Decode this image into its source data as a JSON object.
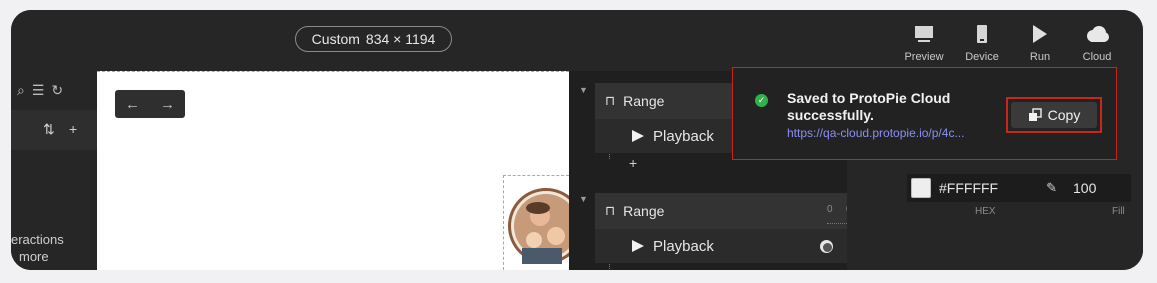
{
  "topbar": {
    "device_preset": "Custom",
    "device_size": "834 × 1194",
    "buttons": [
      {
        "label": "Preview",
        "icon": "monitor-icon"
      },
      {
        "label": "Device",
        "icon": "phone-icon"
      },
      {
        "label": "Run",
        "icon": "play-icon"
      },
      {
        "label": "Cloud",
        "icon": "cloud-icon"
      }
    ]
  },
  "left_panel": {
    "icons": [
      "search-icon",
      "list-icon",
      "refresh-icon"
    ],
    "row_icons": [
      "sort-icon",
      "add-icon"
    ],
    "bottom_text_line1": "eractions",
    "bottom_text_line2": "more"
  },
  "canvas": {
    "nav_back": "←",
    "nav_forward": "→"
  },
  "timeline": {
    "groups": [
      {
        "trigger": "Range",
        "response": "Playback",
        "add": "+"
      },
      {
        "trigger": "Range",
        "response": "Playback",
        "add": "+"
      }
    ],
    "ruler_labels": [
      "0",
      "0"
    ]
  },
  "properties": {
    "color_hex": "#FFFFFF",
    "hex_label": "HEX",
    "fill_value": "100",
    "fill_label": "Fill"
  },
  "toast": {
    "message": "Saved to ProtoPie Cloud successfully.",
    "link": "https://qa-cloud.protopie.io/p/4c...",
    "copy_label": "Copy",
    "highlight_color": "#c8261d"
  }
}
